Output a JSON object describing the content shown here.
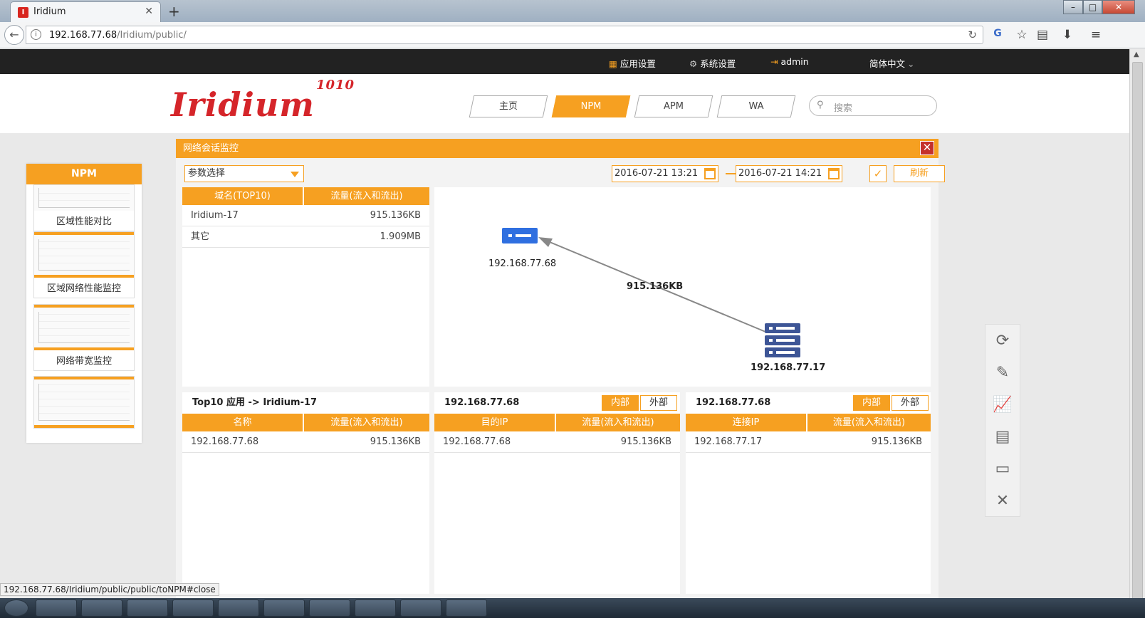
{
  "browser": {
    "tab_title": "Iridium",
    "tab_favicon": "I",
    "url_host": "192.168.77.68",
    "url_path": "/Iridium/public/",
    "status_url": "192.168.77.68/Iridium/public/public/toNPM#close"
  },
  "topbar": {
    "app_settings": "应用设置",
    "system_settings": "系统设置",
    "user": "admin",
    "language": "简体中文"
  },
  "header": {
    "logo_text": "Iridium",
    "logo_sup": "1010",
    "tabs": [
      {
        "label": "主页",
        "active": false
      },
      {
        "label": "NPM",
        "active": true
      },
      {
        "label": "APM",
        "active": false
      },
      {
        "label": "WA",
        "active": false
      }
    ],
    "search_placeholder": "搜索"
  },
  "sidebar": {
    "title": "NPM",
    "items": [
      {
        "label": "区域性能对比"
      },
      {
        "label": "区域网络性能监控"
      },
      {
        "label": "网络带宽监控"
      },
      {
        "label": ""
      }
    ]
  },
  "main": {
    "title": "网络会话监控",
    "param_select": "参数选择",
    "start_time": "2016-07-21 13:21",
    "end_time": "2016-07-21 14:21",
    "refresh_label": "刷新",
    "domain_table": {
      "headers": [
        "域名(TOP10)",
        "流量(流入和流出)"
      ],
      "rows": [
        [
          "Iridium-17",
          "915.136KB"
        ],
        [
          "其它",
          "1.909MB"
        ]
      ]
    },
    "graph": {
      "node_a": "192.168.77.68",
      "node_b": "192.168.77.17",
      "edge_label": "915.136KB"
    },
    "app_table": {
      "title": "Top10 应用 -> Iridium-17",
      "headers": [
        "名称",
        "流量(流入和流出)"
      ],
      "rows": [
        [
          "192.168.77.68",
          "915.136KB"
        ]
      ]
    },
    "dest_table": {
      "title": "192.168.77.68",
      "btn_inner": "内部",
      "btn_outer": "外部",
      "headers": [
        "目的IP",
        "流量(流入和流出)"
      ],
      "rows": [
        [
          "192.168.77.68",
          "915.136KB"
        ]
      ]
    },
    "conn_table": {
      "title": "192.168.77.68",
      "btn_inner": "内部",
      "btn_outer": "外部",
      "headers": [
        "连接IP",
        "流量(流入和流出)"
      ],
      "rows": [
        [
          "192.168.77.17",
          "915.136KB"
        ]
      ]
    }
  },
  "float_toolbar": [
    "refresh-icon",
    "edit-icon",
    "line-chart-icon",
    "document-icon",
    "monitor-icon",
    "close-icon"
  ],
  "colors": {
    "accent": "#f6a021",
    "brand_red": "#d5252a",
    "node_blue": "#2f6fe0",
    "node_navy": "#3d5596"
  }
}
